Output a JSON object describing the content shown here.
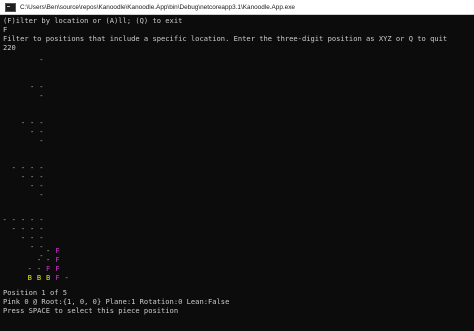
{
  "window": {
    "title": "C:\\Users\\Ben\\source\\repos\\Kanoodle\\Kanoodle.App\\bin\\Debug\\netcoreapp3.1\\Kanoodle.App.exe"
  },
  "console": {
    "menu_prompt": "(F)ilter by location or (A)ll; (Q) to exit",
    "menu_input": "F",
    "filter_prompt": "Filter to positions that include a specific location. Enter the three-digit position as XYZ or Q to quit",
    "filter_input": "220",
    "position_line": "Position 1 of 5",
    "piece_info": "Pink 0 @ Root:{1, 0, 0} Plane:1 Rotation:0 Lean:False",
    "press_space": "Press SPACE to select this piece position"
  },
  "pyramid": {
    "colors": {
      "empty": "#c0c0c0",
      "F": "#d030d0",
      "B": "#e6e600"
    },
    "layers": [
      [
        "-"
      ],
      [
        "- -",
        "-"
      ],
      [
        "- - -",
        "- -",
        "-"
      ],
      [
        "- - - -",
        "- - -",
        "- -",
        "-"
      ],
      [
        "- - - - -",
        "- - - -",
        "- - -",
        "- -",
        "-"
      ]
    ],
    "highlight_layer": {
      "rows": [
        "- F",
        "- - F",
        "- - F F",
        "B B B F"
      ],
      "last_row_trailing": "-"
    }
  }
}
